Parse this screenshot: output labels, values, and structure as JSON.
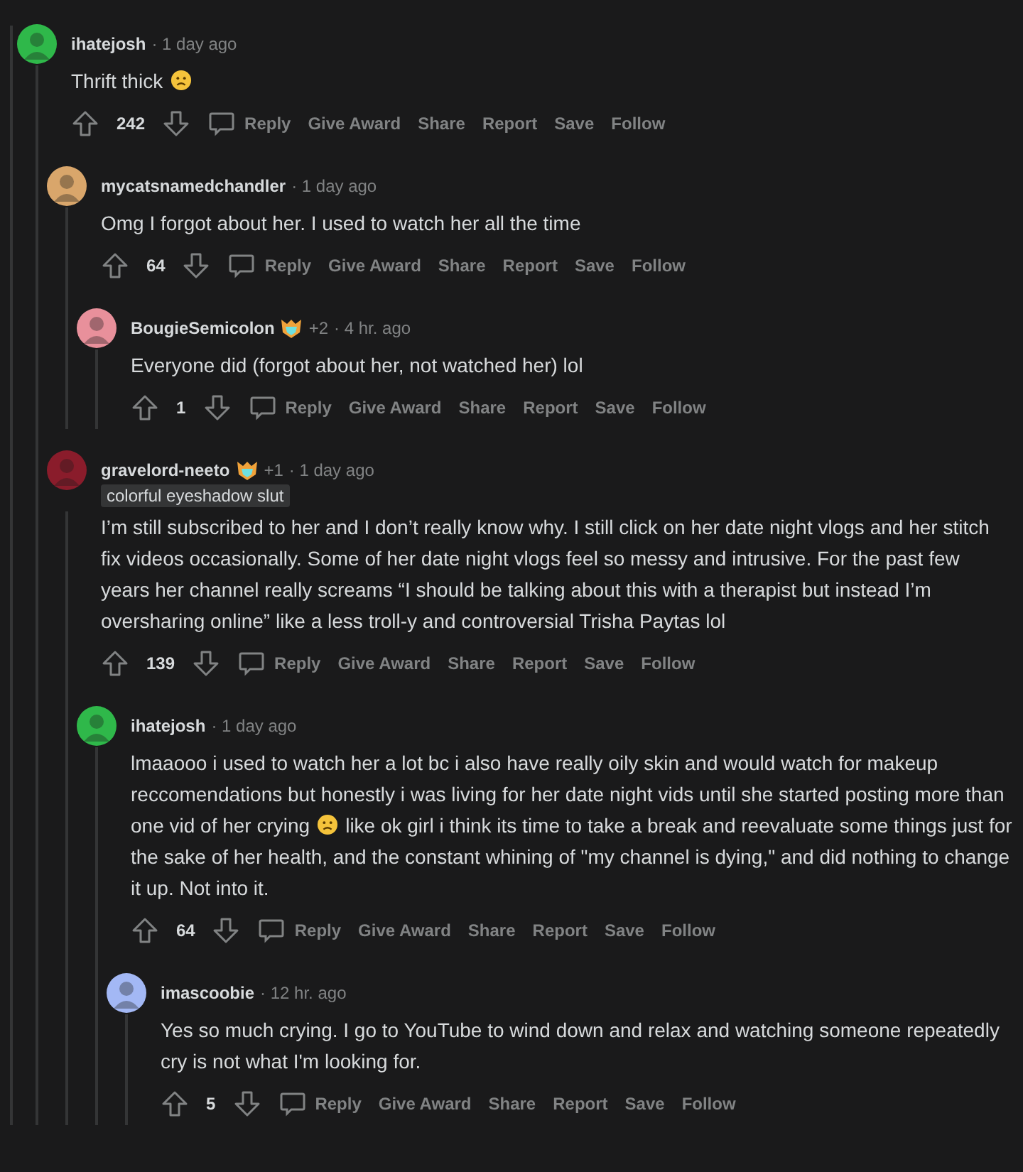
{
  "comments": [
    {
      "author": "ihatejosh",
      "color": "#2fb84a",
      "time": "· 1 day ago",
      "body": [
        {
          "kind": "text",
          "text": "Thrift thick"
        },
        {
          "kind": "emoji"
        }
      ],
      "score": "242",
      "actions": [
        "Reply",
        "Give Award",
        "Share",
        "Report",
        "Save",
        "Follow"
      ],
      "children": [
        {
          "author": "mycatsnamedchandler",
          "color": "#d9a66b",
          "time": "· 1 day ago",
          "body": [
            {
              "kind": "text",
              "text": "Omg I forgot about her. I used to watch her all the time"
            }
          ],
          "score": "64",
          "actions": [
            "Reply",
            "Give Award",
            "Share",
            "Report",
            "Save",
            "Follow"
          ],
          "children": [
            {
              "author": "BougieSemicolon",
              "color": "#e8909b",
              "awards": "+2",
              "time": "· 4 hr. ago",
              "body": [
                {
                  "kind": "text",
                  "text": "Everyone did (forgot about her, not watched her) lol"
                }
              ],
              "score": "1",
              "actions": [
                "Reply",
                "Give Award",
                "Share",
                "Report",
                "Save",
                "Follow"
              ]
            }
          ]
        },
        {
          "author": "gravelord-neeto",
          "color": "#8a1c2b",
          "awards": "+1",
          "time": "· 1 day ago",
          "flair": "colorful eyeshadow slut",
          "body": [
            {
              "kind": "text",
              "text": "I’m still subscribed to her and I don’t really know why. I still click on her date night vlogs and her stitch fix videos occasionally. Some of her date night vlogs feel so messy and intrusive. For the past few years her channel really screams “I should be talking about this with a therapist but instead I’m oversharing online” like a less troll-y and controversial Trisha Paytas lol"
            }
          ],
          "score": "139",
          "actions": [
            "Reply",
            "Give Award",
            "Share",
            "Report",
            "Save",
            "Follow"
          ],
          "children": [
            {
              "author": "ihatejosh",
              "color": "#2fb84a",
              "time": "· 1 day ago",
              "body": [
                {
                  "kind": "text",
                  "text": "lmaaooo i used to watch her a lot bc i also have really oily skin and would watch for makeup reccomendations but honestly i was living for her date night vids until she started posting more than one vid of her crying"
                },
                {
                  "kind": "emoji"
                },
                {
                  "kind": "text",
                  "text": "like ok girl i think its time to take a break and reevaluate some things just for the sake of her health, and the constant whining of \"my channel is dying,\" and did nothing to change it up. Not into it."
                }
              ],
              "score": "64",
              "actions": [
                "Reply",
                "Give Award",
                "Share",
                "Report",
                "Save",
                "Follow"
              ],
              "children": [
                {
                  "author": "imascoobie",
                  "color": "#a3b8f5",
                  "time": "· 12 hr. ago",
                  "body": [
                    {
                      "kind": "text",
                      "text": "Yes so much crying. I go to YouTube to wind down and relax and watching someone repeatedly cry is not what I'm looking for."
                    }
                  ],
                  "score": "5",
                  "actions": [
                    "Reply",
                    "Give Award",
                    "Share",
                    "Report",
                    "Save",
                    "Follow"
                  ]
                }
              ]
            }
          ]
        }
      ]
    }
  ]
}
